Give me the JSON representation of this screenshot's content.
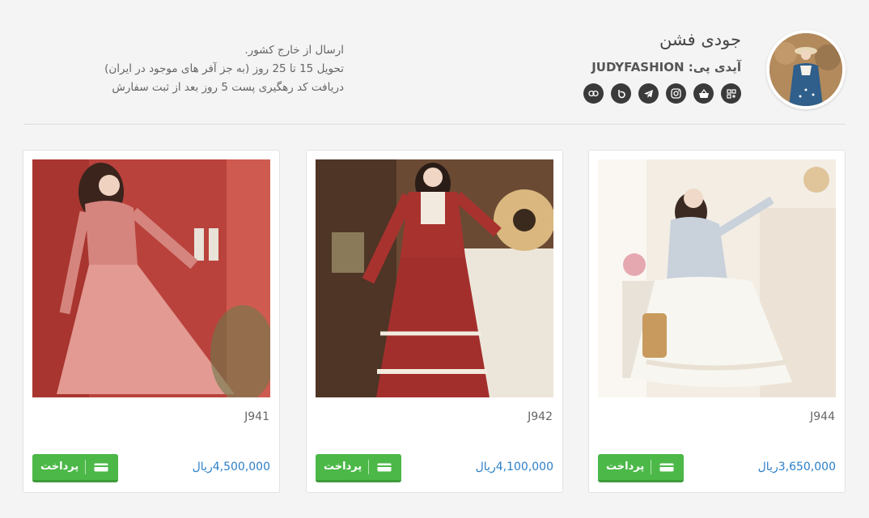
{
  "shop": {
    "name": "جودی فشن",
    "id_label": "آیدی پی: JUDYFASHION",
    "social_icons": [
      "qr-code-icon",
      "basket-icon",
      "instagram-icon",
      "telegram-icon",
      "bale-icon",
      "link-icon"
    ]
  },
  "notes": {
    "line1": "ارسال از خارج کشور.",
    "line2": "تحویل 15 تا 25 روز (به جز آفر های موجود در ایران)",
    "line3": "دریافت کد رهگیری پست 5 روز بعد از ثبت سفارش"
  },
  "products": [
    {
      "code": "J944",
      "price": "3,650,000",
      "currency": "ریال",
      "pay_label": "پرداخت"
    },
    {
      "code": "J942",
      "price": "4,100,000",
      "currency": "ریال",
      "pay_label": "پرداخت"
    },
    {
      "code": "J941",
      "price": "4,500,000",
      "currency": "ریال",
      "pay_label": "پرداخت"
    }
  ],
  "colors": {
    "accent_green": "#4cb848",
    "price_blue": "#2b7fc8",
    "icon_dark": "#3a3a3a"
  }
}
